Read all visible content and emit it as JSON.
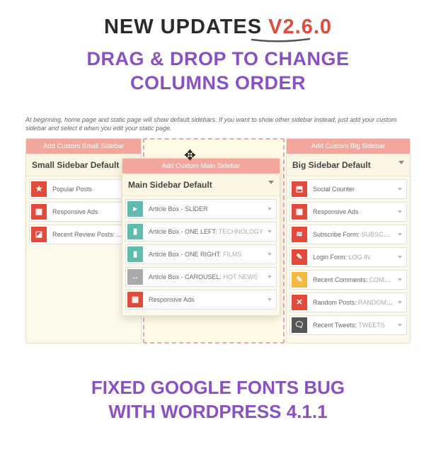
{
  "heading": {
    "left": "NEW UPDATES ",
    "right": "V2.6.0"
  },
  "subheading_l1": "DRAG & DROP TO CHANGE",
  "subheading_l2": "COLUMNS ORDER",
  "note": "At beginning, home page and static page will show default sidebars. If you want to show other sidebar instead, just add your custom sidebar and select it when you edit your static page.",
  "left_col": {
    "add_label": "Add Custom Small Sidebar",
    "title": "Small Sidebar Default",
    "items": [
      {
        "icon": "★",
        "cls": "ic-red",
        "label": "Popular Posts",
        "suffix": ""
      },
      {
        "icon": "▦",
        "cls": "ic-red",
        "label": "Responsive Ads",
        "suffix": ""
      },
      {
        "icon": "◪",
        "cls": "ic-red",
        "label": "Recent Review Posts: ",
        "suffix": "Re..."
      }
    ]
  },
  "center_panel": {
    "add_label": "Add Custom Main Sidebar",
    "title": "Main Sidebar Default",
    "items": [
      {
        "icon": "▸",
        "cls": "ic-teal",
        "label": "Article Box - SLIDER",
        "suffix": ""
      },
      {
        "icon": "▮",
        "cls": "ic-teal",
        "label": "Article Box - ONE LEFT: ",
        "suffix": "TECHNOLOGY"
      },
      {
        "icon": "▮",
        "cls": "ic-teal",
        "label": "Article Box - ONE RIGHT: ",
        "suffix": "FILMS"
      },
      {
        "icon": "↔",
        "cls": "ic-gray",
        "label": "Article Box - CAROUSEL: ",
        "suffix": "HOT NEWS"
      },
      {
        "icon": "▦",
        "cls": "ic-red",
        "label": "Responsive Ads",
        "suffix": ""
      }
    ]
  },
  "right_col": {
    "add_label": "Add Custom Big Sidebar",
    "title": "Big Sidebar Default",
    "items": [
      {
        "icon": "⬒",
        "cls": "ic-red",
        "label": "Social Counter",
        "suffix": ""
      },
      {
        "icon": "▦",
        "cls": "ic-red",
        "label": "Responsive Ads",
        "suffix": ""
      },
      {
        "icon": "≋",
        "cls": "ic-red",
        "label": "Subscribe Form: ",
        "suffix": "SUBSCRIBE"
      },
      {
        "icon": "✎",
        "cls": "ic-red",
        "label": "Login Form: ",
        "suffix": "LOG IN"
      },
      {
        "icon": "✎",
        "cls": "ic-yellow",
        "label": "Recent Comments: ",
        "suffix": "COMMENTS"
      },
      {
        "icon": "✕",
        "cls": "ic-red",
        "label": "Random Posts: ",
        "suffix": "RANDOM ARTIC..."
      },
      {
        "icon": "🗨",
        "cls": "ic-dark",
        "label": "Recent Tweets: ",
        "suffix": "TWEETS"
      }
    ]
  },
  "footer_l1": "FIXED GOOGLE FONTS BUG",
  "footer_l2": "WITH WORDPRESS 4.1.1"
}
